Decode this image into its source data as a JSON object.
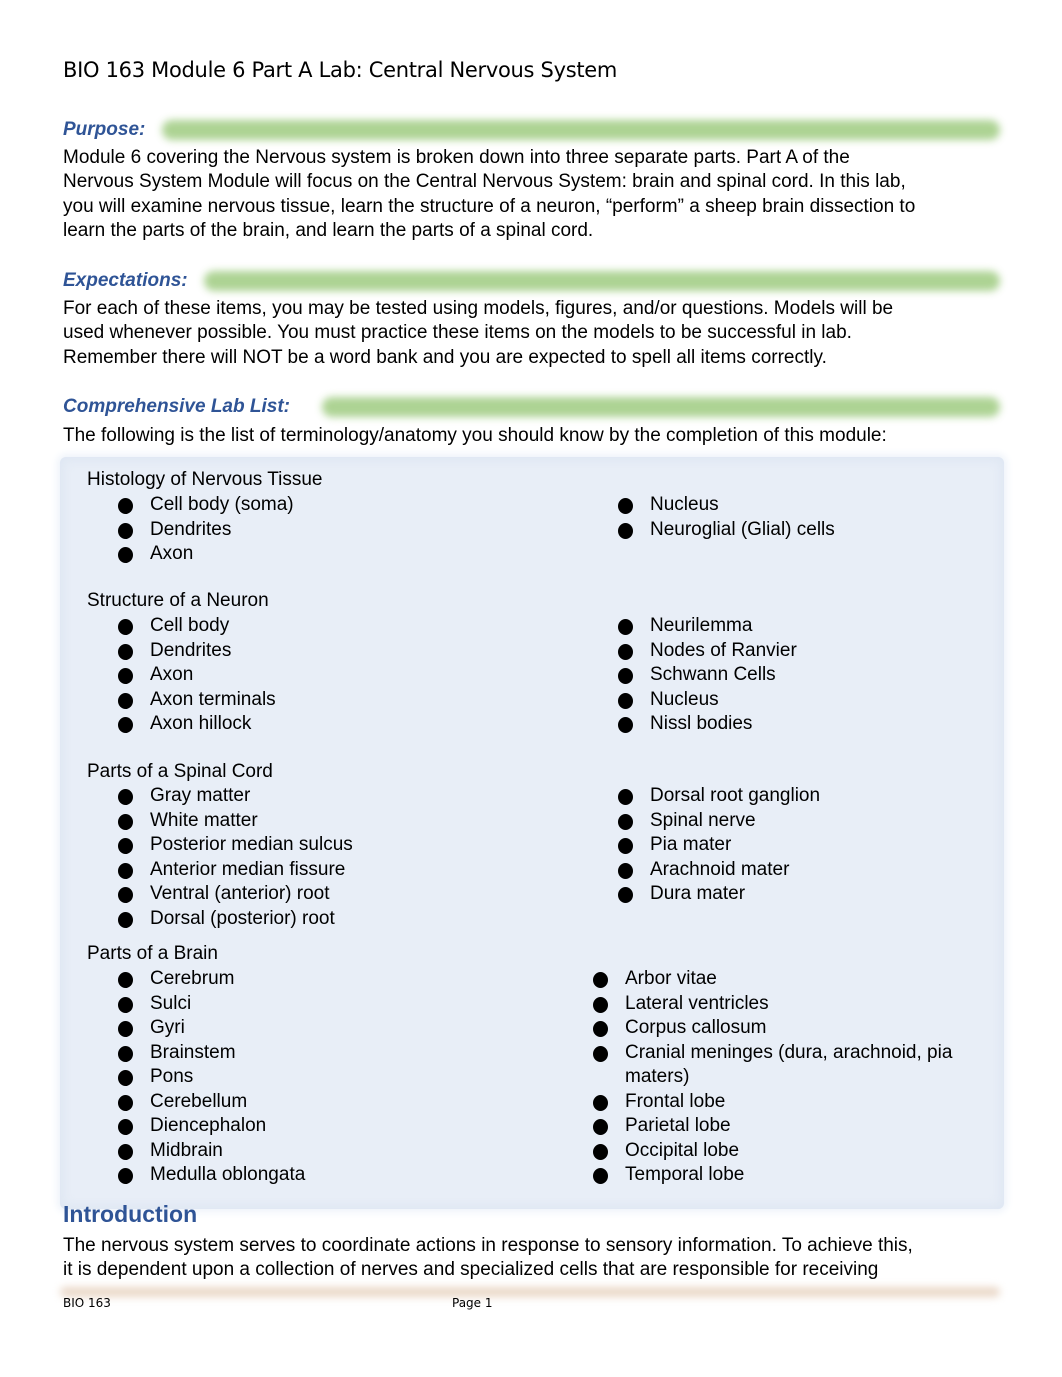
{
  "document": {
    "title": "BIO 163 Module 6 Part A Lab: Central Nervous System",
    "colors": {
      "heading": "#2f5496",
      "highlight": "#a9d18e",
      "listbox": "#e8eef7"
    }
  },
  "purpose": {
    "heading": "Purpose:",
    "lines": [
      "Module 6 covering the Nervous system is broken down into three separate parts. Part A of the",
      "Nervous System Module will focus on the Central Nervous System: brain and spinal cord. In this lab,",
      "you will examine nervous tissue, learn the structure of a neuron, “perform” a sheep brain dissection to",
      "learn the parts of the brain, and learn the parts of a spinal cord."
    ]
  },
  "expectations": {
    "heading": "Expectations:",
    "lines": [
      "For each of these items, you may be tested using models, figures, and/or questions. Models will be",
      "used whenever possible. You must practice these items on the models to be successful in lab.",
      "Remember there will NOT be a word bank and you are expected to spell all items correctly."
    ]
  },
  "lab_list": {
    "heading": "Comprehensive Lab List:",
    "intro": "The following is the list of terminology/anatomy you should know by the completion of this module:",
    "groups": [
      {
        "title": "Histology of Nervous Tissue",
        "left": [
          "Cell body (soma)",
          "Dendrites",
          "Axon"
        ],
        "right": [
          "Nucleus",
          "Neuroglial (Glial) cells"
        ]
      },
      {
        "title": "Structure of a Neuron",
        "left": [
          "Cell body",
          "Dendrites",
          "Axon",
          "Axon terminals",
          "Axon hillock"
        ],
        "right": [
          "Neurilemma",
          "Nodes of Ranvier",
          "Schwann Cells",
          "Nucleus",
          "Nissl bodies"
        ]
      },
      {
        "title": "Parts of a Spinal Cord",
        "left": [
          "Gray matter",
          "White matter",
          "Posterior median sulcus",
          "Anterior median fissure",
          "Ventral (anterior) root",
          "Dorsal (posterior) root"
        ],
        "right": [
          "Dorsal root ganglion",
          "Spinal nerve",
          "Pia mater",
          "Arachnoid mater",
          "Dura mater"
        ]
      },
      {
        "title": "Parts of a Brain",
        "left": [
          "Cerebrum",
          "Sulci",
          "Gyri",
          "Brainstem",
          "Pons",
          "Cerebellum",
          "Diencephalon",
          "Midbrain",
          "Medulla oblongata"
        ],
        "right": [
          "Arbor vitae",
          "Lateral ventricles",
          "Corpus callosum",
          "Cranial meninges (dura, arachnoid, pia maters)",
          "Frontal lobe",
          "Parietal lobe",
          "Occipital lobe",
          "Temporal lobe"
        ]
      }
    ]
  },
  "introduction": {
    "heading": "Introduction",
    "lines": [
      "The nervous system serves to coordinate actions in response to sensory information. To achieve this,",
      "it is dependent upon a collection of nerves and specialized cells that are responsible for receiving"
    ]
  },
  "footer": {
    "left": "BIO 163",
    "page": "Page 1"
  }
}
